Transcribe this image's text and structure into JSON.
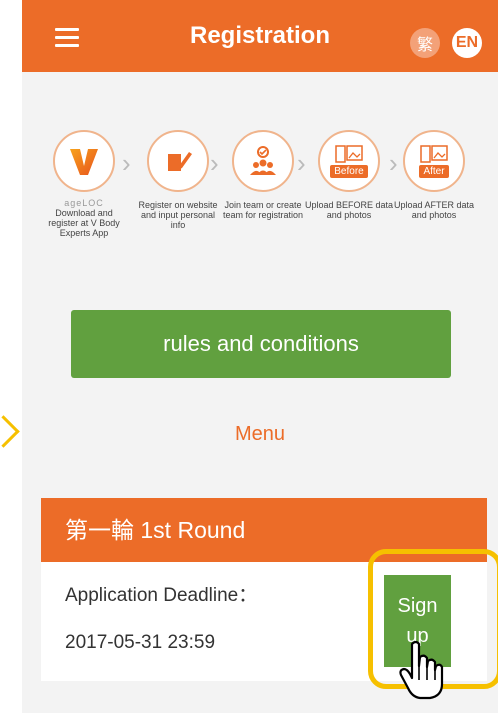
{
  "header": {
    "title": "Registration",
    "lang_zh": "繁",
    "lang_en": "EN"
  },
  "steps": [
    {
      "icon": "v-logo-icon",
      "logo_text": "ageLOC",
      "label": "Download and register at V Body Experts App"
    },
    {
      "icon": "document-pen-icon",
      "label": "Register on website and input personal info"
    },
    {
      "icon": "team-icon",
      "label": "Join team or create team for registration"
    },
    {
      "icon": "before-photos-icon",
      "badge": "Before",
      "label": "Upload BEFORE data and photos"
    },
    {
      "icon": "after-photos-icon",
      "badge": "After",
      "label": "Upload AFTER data and photos"
    }
  ],
  "rules_button": "rules and conditions",
  "menu_label": "Menu",
  "round": {
    "title": "第一輪 1st Round",
    "deadline_label": "Application Deadline：",
    "deadline_value": "2017-05-31 23:59",
    "signup_label": "Sign up"
  },
  "colors": {
    "accent": "#ec6c28",
    "green": "#61a03f",
    "highlight": "#f6c000"
  }
}
